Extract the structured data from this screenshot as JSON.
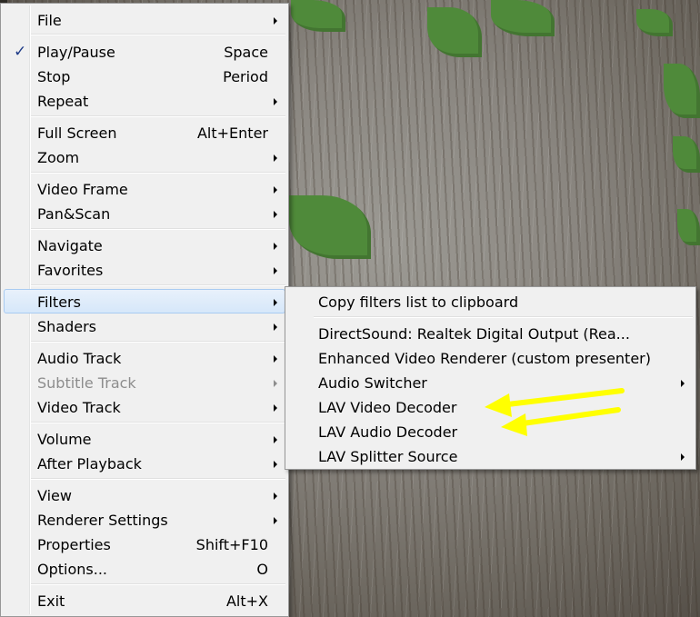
{
  "colors": {
    "menu_bg": "#f0f0f0",
    "highlight": "#d6e7fa",
    "annotation": "#ffff00",
    "disabled_text": "#8d8d8d"
  },
  "main_menu": {
    "file": {
      "label": "File"
    },
    "play_pause": {
      "label": "Play/Pause",
      "shortcut": "Space",
      "checked": true
    },
    "stop": {
      "label": "Stop",
      "shortcut": "Period"
    },
    "repeat": {
      "label": "Repeat"
    },
    "full_screen": {
      "label": "Full Screen",
      "shortcut": "Alt+Enter"
    },
    "zoom": {
      "label": "Zoom"
    },
    "video_frame": {
      "label": "Video Frame"
    },
    "pan_scan": {
      "label": "Pan&Scan"
    },
    "navigate": {
      "label": "Navigate"
    },
    "favorites": {
      "label": "Favorites"
    },
    "filters": {
      "label": "Filters"
    },
    "shaders": {
      "label": "Shaders"
    },
    "audio_track": {
      "label": "Audio Track"
    },
    "subtitle_track": {
      "label": "Subtitle Track",
      "disabled": true
    },
    "video_track": {
      "label": "Video Track"
    },
    "volume": {
      "label": "Volume"
    },
    "after_playback": {
      "label": "After Playback"
    },
    "view": {
      "label": "View"
    },
    "renderer_settings": {
      "label": "Renderer Settings"
    },
    "properties": {
      "label": "Properties",
      "shortcut": "Shift+F10"
    },
    "options": {
      "label": "Options...",
      "shortcut": "O"
    },
    "exit": {
      "label": "Exit",
      "shortcut": "Alt+X"
    }
  },
  "filters_submenu": {
    "copy_list": {
      "label": "Copy filters list to clipboard"
    },
    "directsound": {
      "label": "DirectSound: Realtek Digital Output (Rea..."
    },
    "evr": {
      "label": "Enhanced Video Renderer (custom presenter)"
    },
    "audio_switcher": {
      "label": "Audio Switcher"
    },
    "lav_video": {
      "label": "LAV Video Decoder"
    },
    "lav_audio": {
      "label": "LAV Audio Decoder"
    },
    "lav_splitter": {
      "label": "LAV Splitter Source"
    }
  },
  "icons": {
    "check": "checkmark-icon",
    "submenu": "submenu-arrow-icon",
    "annotation": "yellow-arrow-icon"
  }
}
